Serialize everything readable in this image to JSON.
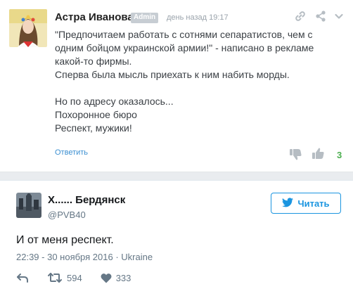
{
  "comment": {
    "author": "Астра Иванова",
    "badge": "Admin",
    "timestamp": "день назад 19:17",
    "lines": [
      "\"Предпочитаем работать с сотнями сепаратистов, чем с",
      "одним бойцом украинской армии!\" - написано в рекламе",
      "какой-то фирмы.",
      "Сперва была мысль приехать к ним набить морды."
    ],
    "lines2": [
      "Но по адресу оказалось...",
      "Похоронное бюро",
      "Респект, мужики!"
    ],
    "reply_label": "Ответить",
    "vote_count": "3",
    "icons": [
      "link-icon",
      "share-icon",
      "chevron-down-icon",
      "thumbs-down-icon",
      "thumbs-up-icon"
    ]
  },
  "tweet": {
    "name": "Х...... Бердянск",
    "handle": "@PVB40",
    "follow_label": "Читать",
    "text": "И от меня респект.",
    "meta": "22:39 - 30 ноября 2016 · Ukraine",
    "retweets": "594",
    "likes": "333",
    "colors": {
      "twitter_blue": "#1b95e0",
      "vote_green": "#4caf50",
      "link_blue": "#3b8fd1"
    }
  }
}
